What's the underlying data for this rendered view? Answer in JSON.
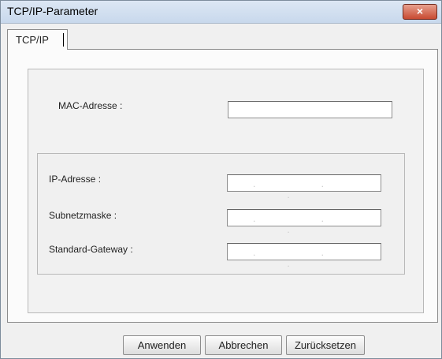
{
  "window": {
    "title": "TCP/IP-Parameter",
    "close_symbol": "×"
  },
  "tabs": [
    {
      "label": "TCP/IP",
      "active": true
    }
  ],
  "form": {
    "mac_label": "MAC-Adresse :",
    "mac_value": "",
    "ip_label": "IP-Adresse :",
    "ip_value": ". . .",
    "subnet_label": "Subnetzmaske :",
    "subnet_value": ". . .",
    "gateway_label": "Standard-Gateway :",
    "gateway_value": ". . ."
  },
  "buttons": {
    "apply": "Anwenden",
    "cancel": "Abbrechen",
    "reset": "Zurücksetzen"
  }
}
